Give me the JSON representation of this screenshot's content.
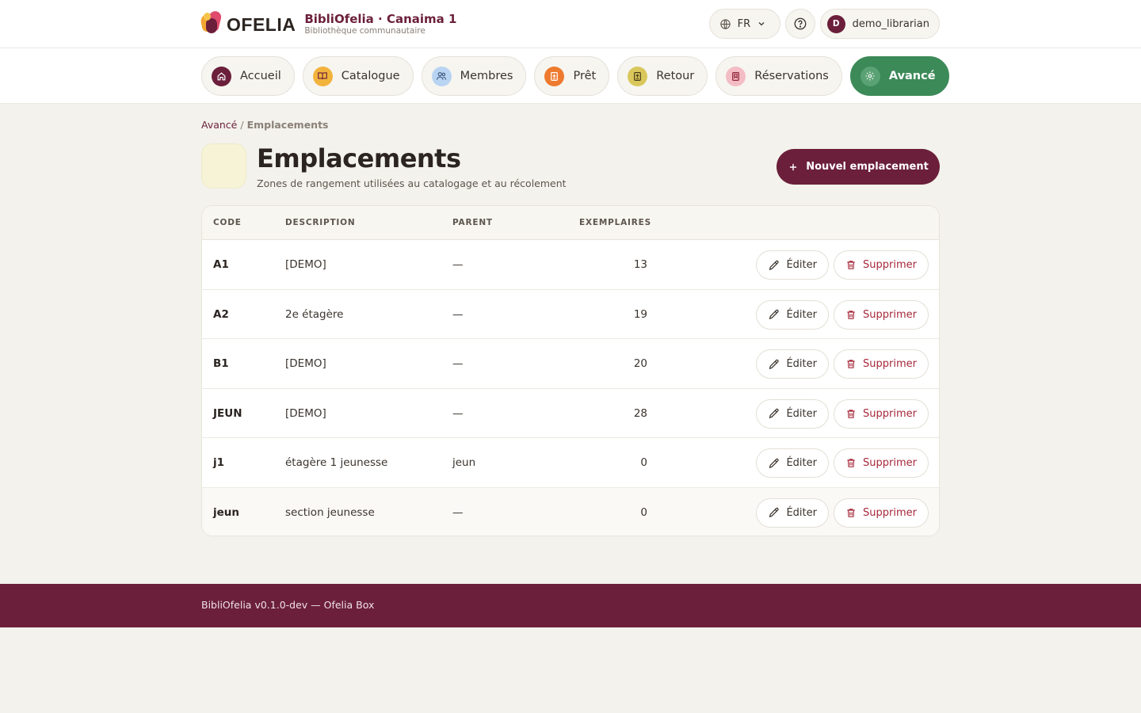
{
  "app": {
    "logo_text": "OFELIA",
    "title": "BibliOfelia · Canaima 1",
    "subtitle": "Bibliothèque communautaire"
  },
  "header": {
    "language": "FR",
    "user": {
      "initial": "D",
      "name": "demo_librarian"
    }
  },
  "nav": [
    {
      "label": "Accueil",
      "icon": "home-icon",
      "color": "#6b1f3a"
    },
    {
      "label": "Catalogue",
      "icon": "book-open-icon",
      "color": "#f2b33d"
    },
    {
      "label": "Membres",
      "icon": "users-icon",
      "color": "#b9d4f2"
    },
    {
      "label": "Prêt",
      "icon": "checkout-book-icon",
      "color": "#ee7a2f"
    },
    {
      "label": "Retour",
      "icon": "return-book-icon",
      "color": "#d9c75c"
    },
    {
      "label": "Réservations",
      "icon": "bookmark-icon",
      "color": "#f4bcc4"
    },
    {
      "label": "Avancé",
      "icon": "gear-icon",
      "color": "#5aa274",
      "active": true
    }
  ],
  "breadcrumb": {
    "parent": "Avancé",
    "separator": "/",
    "current": "Emplacements"
  },
  "page": {
    "title": "Emplacements",
    "subtitle": "Zones de rangement utilisées au catalogage et au récolement",
    "new_button": "Nouvel emplacement"
  },
  "table": {
    "columns": [
      "CODE",
      "DESCRIPTION",
      "PARENT",
      "EXEMPLAIRES"
    ],
    "edit_label": "Éditer",
    "delete_label": "Supprimer",
    "rows": [
      {
        "code": "A1",
        "description": "[DEMO]",
        "parent": "—",
        "count": "13"
      },
      {
        "code": "A2",
        "description": "2e étagère",
        "parent": "—",
        "count": "19"
      },
      {
        "code": "B1",
        "description": "[DEMO]",
        "parent": "—",
        "count": "20"
      },
      {
        "code": "JEUN",
        "description": "[DEMO]",
        "parent": "—",
        "count": "28"
      },
      {
        "code": "j1",
        "description": "étagère 1 jeunesse",
        "parent": "jeun",
        "count": "0"
      },
      {
        "code": "jeun",
        "description": "section jeunesse",
        "parent": "—",
        "count": "0"
      }
    ]
  },
  "footer": {
    "text": "BibliOfelia v0.1.0-dev — Ofelia Box"
  },
  "colors": {
    "brand": "#6b1f3a",
    "accent_green": "#3c8a58",
    "danger": "#a6283a",
    "background": "#f3f2ec"
  }
}
